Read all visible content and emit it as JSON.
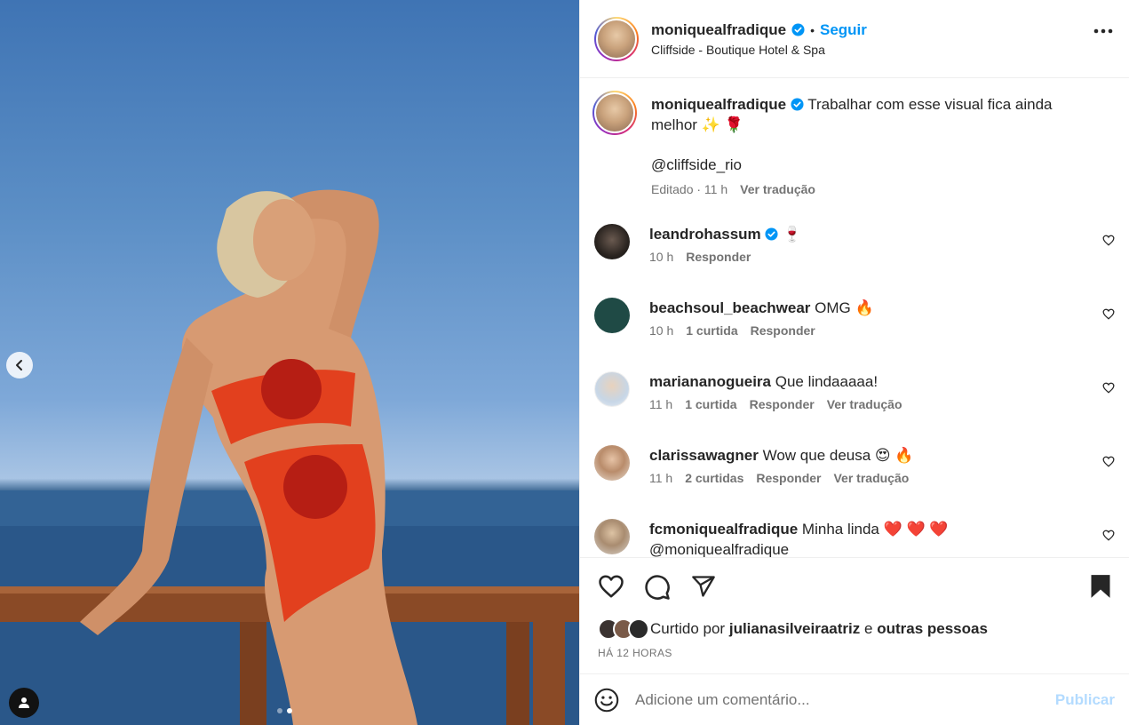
{
  "post": {
    "username": "moniquealfradique",
    "follow_label": "Seguir",
    "separator": "•",
    "location": "Cliffside - Boutique Hotel & Spa"
  },
  "caption": {
    "username": "moniquealfradique",
    "text": "Trabalhar com esse visual fica ainda melhor ✨ 🌹",
    "mention": "@cliffside_rio",
    "edited": "Editado · 11 h",
    "translate": "Ver tradução"
  },
  "comments": [
    {
      "username": "leandrohassum",
      "verified": true,
      "text": "🍷",
      "time": "10 h",
      "likes": "",
      "reply": "Responder",
      "translate": ""
    },
    {
      "username": "beachsoul_beachwear",
      "verified": false,
      "text": "OMG 🔥",
      "time": "10 h",
      "likes": "1 curtida",
      "reply": "Responder",
      "translate": ""
    },
    {
      "username": "mariananogueira",
      "verified": false,
      "text": "Que lindaaaaa!",
      "time": "11 h",
      "likes": "1 curtida",
      "reply": "Responder",
      "translate": "Ver tradução"
    },
    {
      "username": "clarissawagner",
      "verified": false,
      "text": "Wow que deusa 😍 🔥",
      "time": "11 h",
      "likes": "2 curtidas",
      "reply": "Responder",
      "translate": "Ver tradução"
    },
    {
      "username": "fcmoniquealfradique",
      "verified": false,
      "text": "Minha linda ❤️ ❤️ ❤️",
      "mention": "@moniquealfradique",
      "time": "",
      "likes": "",
      "reply": "",
      "translate": ""
    }
  ],
  "likes": {
    "prefix": "Curtido por",
    "user": "julianasilveiraatriz",
    "conj": "e",
    "others": "outras pessoas"
  },
  "timestamp": "HÁ 12 HORAS",
  "composer": {
    "placeholder": "Adicione um comentário...",
    "publish": "Publicar"
  },
  "carousel": {
    "current": 2,
    "total": 2
  },
  "colors": {
    "accent": "#0095f6",
    "text": "#262626",
    "muted": "#737373",
    "link": "#00376b"
  },
  "icons": [
    "verified-badge-icon",
    "more-options-icon",
    "heart-icon",
    "comment-icon",
    "share-icon",
    "bookmark-icon",
    "emoji-icon",
    "chevron-left-icon",
    "user-tag-icon"
  ]
}
